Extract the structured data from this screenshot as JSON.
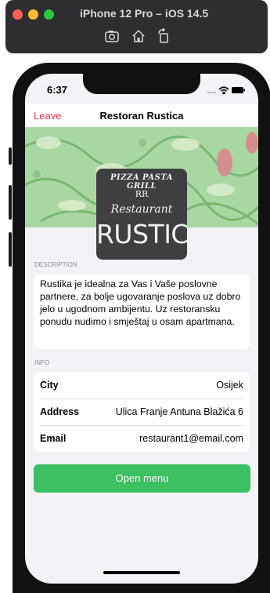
{
  "simulator": {
    "title": "iPhone 12 Pro – iOS 14.5",
    "icons": [
      "screenshot-icon",
      "home-icon",
      "rotate-icon"
    ]
  },
  "status_bar": {
    "time": "6:37"
  },
  "navbar": {
    "leave_label": "Leave",
    "title": "Restoran Rustica"
  },
  "logo": {
    "top_text": "PIZZA PASTA GRILL",
    "monogram": "RR",
    "script_text": "Restaurant",
    "main_text": "RUSTICA"
  },
  "description": {
    "section_label": "DESCRIPTION",
    "text": "Rustika je idealna za Vas i Vaše poslovne partnere, za bolje ugovaranje poslova uz dobro jelo u ugodnom ambijentu. Uz restoransku ponudu nudimo i smještaj u osam apartmana."
  },
  "info": {
    "section_label": "INFO",
    "rows": [
      {
        "label": "City",
        "value": "Osijek"
      },
      {
        "label": "Address",
        "value": "Ulica Franje Antuna Blažića 6"
      },
      {
        "label": "Email",
        "value": "restaurant1@email.com"
      }
    ]
  },
  "open_menu_label": "Open menu",
  "colors": {
    "accent_red": "#e0384c",
    "button_green": "#3cc062",
    "background": "#f2f2f7",
    "banner_green": "#a9d7a2"
  }
}
